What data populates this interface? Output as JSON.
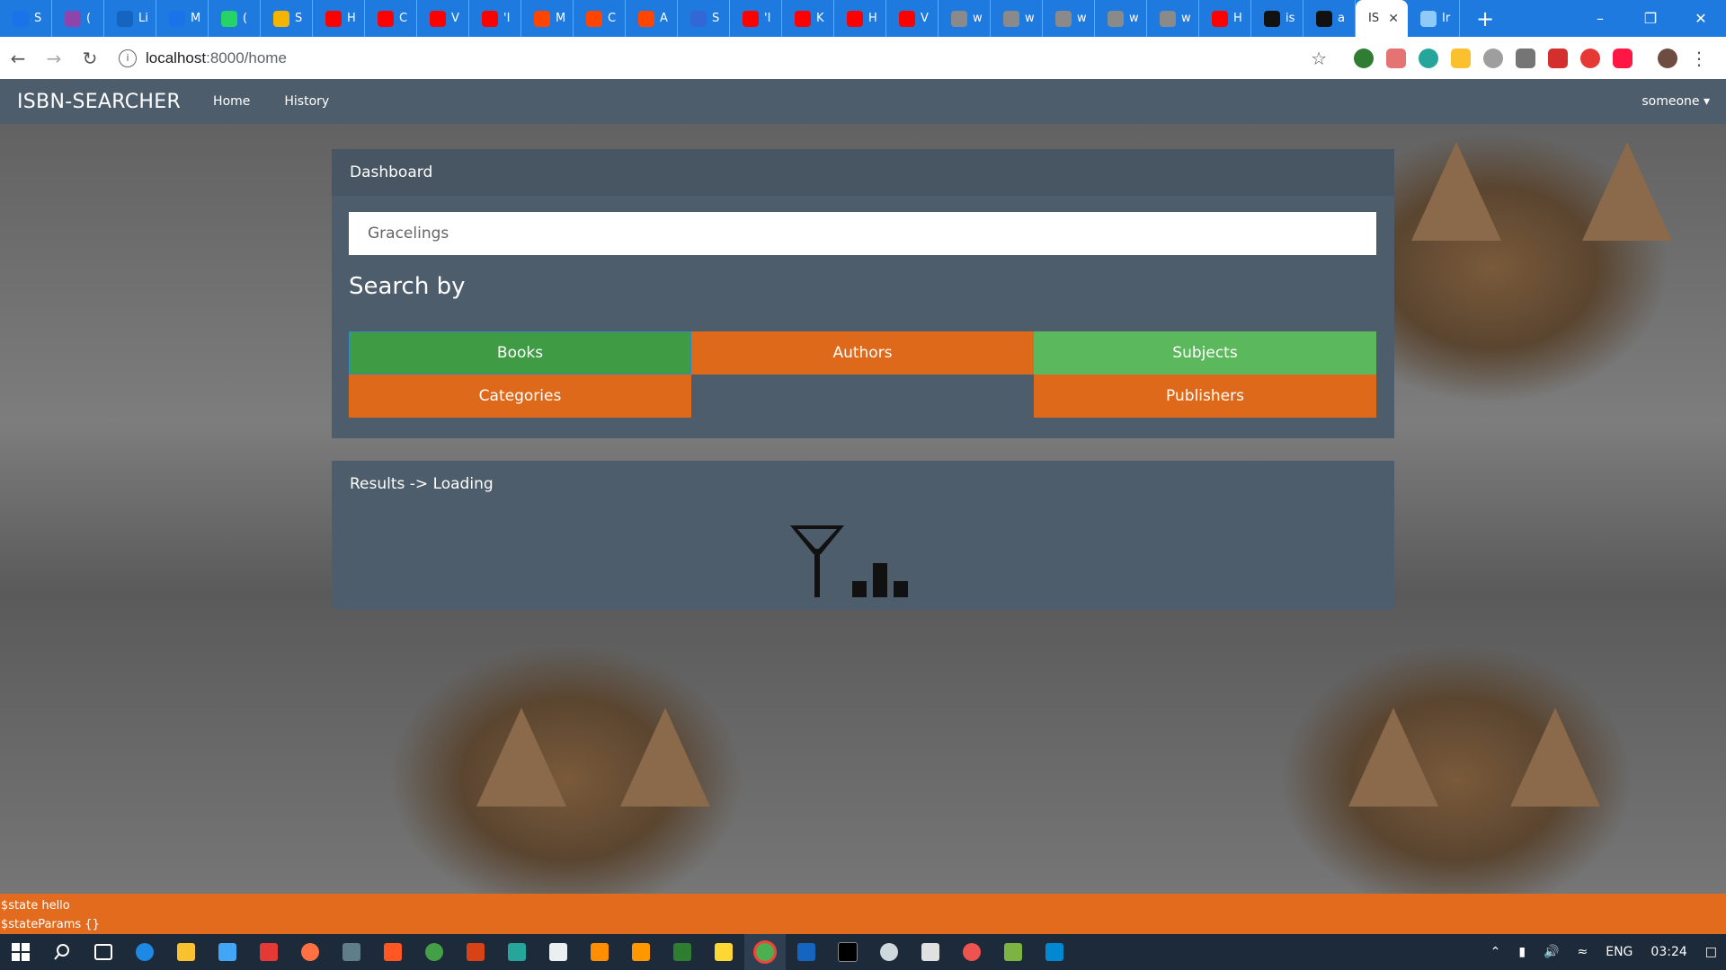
{
  "browser": {
    "tabs": [
      {
        "label": "S",
        "color": "#1a73e8"
      },
      {
        "label": "(",
        "color": "#8e44ad"
      },
      {
        "label": "Li",
        "color": "#1565c0"
      },
      {
        "label": "M",
        "color": "#1a73e8"
      },
      {
        "label": "(",
        "color": "#25d366"
      },
      {
        "label": "S",
        "color": "#f4b400"
      },
      {
        "label": "H",
        "color": "#ff0000"
      },
      {
        "label": "C",
        "color": "#ff0000"
      },
      {
        "label": "V",
        "color": "#ff0000"
      },
      {
        "label": "'I",
        "color": "#ff0000"
      },
      {
        "label": "M",
        "color": "#ff4500"
      },
      {
        "label": "C",
        "color": "#ff4500"
      },
      {
        "label": "A",
        "color": "#ff4500"
      },
      {
        "label": "S",
        "color": "#3367d6"
      },
      {
        "label": "'I",
        "color": "#ff0000"
      },
      {
        "label": "K",
        "color": "#ff0000"
      },
      {
        "label": "H",
        "color": "#ff0000"
      },
      {
        "label": "V",
        "color": "#ff0000"
      },
      {
        "label": "w",
        "color": "#8a8a8a"
      },
      {
        "label": "w",
        "color": "#8a8a8a"
      },
      {
        "label": "w",
        "color": "#8a8a8a"
      },
      {
        "label": "w",
        "color": "#8a8a8a"
      },
      {
        "label": "w",
        "color": "#8a8a8a"
      },
      {
        "label": "H",
        "color": "#ff0000"
      },
      {
        "label": "is",
        "color": "#111111"
      },
      {
        "label": "a",
        "color": "#111111"
      }
    ],
    "active_tab": {
      "label": "IS"
    },
    "trailing_tab": {
      "label": "Ir"
    },
    "url_host": "localhost",
    "url_path": ":8000/home"
  },
  "navbar": {
    "brand": "ISBN-SEARCHER",
    "links": [
      "Home",
      "History"
    ],
    "user": "someone"
  },
  "dashboard": {
    "heading": "Dashboard",
    "search_value": "Gracelings",
    "search_by": "Search by",
    "buttons": {
      "books": "Books",
      "authors": "Authors",
      "subjects": "Subjects",
      "categories": "Categories",
      "publishers": "Publishers"
    }
  },
  "results": {
    "heading": "Results -> Loading"
  },
  "debug": {
    "line1": "$state hello",
    "line2": "$stateParams {}"
  },
  "tray": {
    "language": "ENG",
    "time": "03:24"
  },
  "colors": {
    "navbar": "#4e5d6c",
    "panel": "#4e5d6c",
    "green_active": "#3f9c44",
    "green": "#5cb85c",
    "orange": "#df691a"
  }
}
